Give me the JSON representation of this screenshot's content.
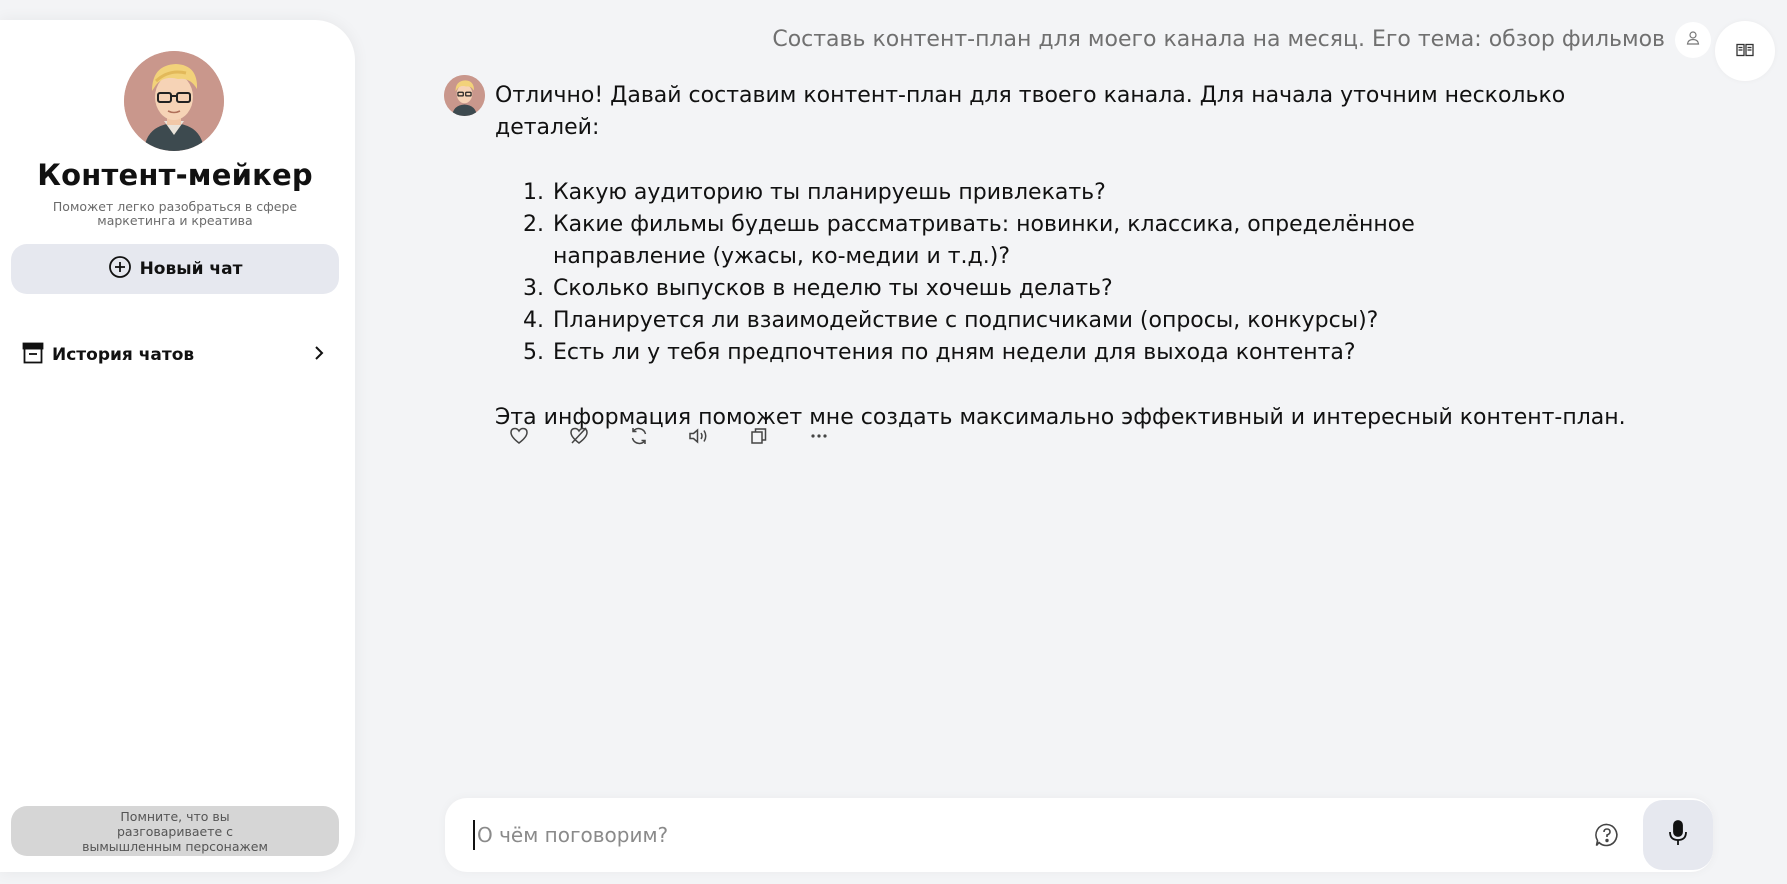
{
  "sidebar": {
    "bot_name": "Контент-мейкер",
    "bot_description": "Поможет легко разобраться в сфере маркетинга и креатива",
    "new_chat_label": "Новый чат",
    "history_label": "История чатов",
    "reminder": "Помните, что вы разговариваете с вымышленным персонажем"
  },
  "chat": {
    "user_message": "Составь контент-план для моего канала на месяц. Его тема: обзор фильмов",
    "reply_intro": "Отлично! Давай составим контент-план для твоего канала. Для начала уточним несколько деталей:",
    "reply_items": [
      "Какую аудиторию ты планируешь привлекать?",
      "Какие фильмы будешь рассматривать: новинки, классика, определённое направление (ужасы, ко-медии и т.д.)?",
      "Сколько выпусков в неделю ты хочешь делать?",
      "Планируется ли взаимодействие с подписчиками (опросы, конкурсы)?",
      "Есть ли у тебя предпочтения по дням недели для выхода контента?"
    ],
    "reply_outro": "Эта информация поможет мне создать максимально эффективный и интересный контент-план.",
    "actions": [
      "heart-icon",
      "dislike-icon",
      "regenerate-icon",
      "speaker-icon",
      "copy-icon",
      "more-icon"
    ]
  },
  "composer": {
    "placeholder": "О чём поговорим?"
  },
  "colors": {
    "background": "#f3f4f6",
    "button_bg": "#e6e8ef",
    "reminder_bg": "#d6d6d6"
  }
}
